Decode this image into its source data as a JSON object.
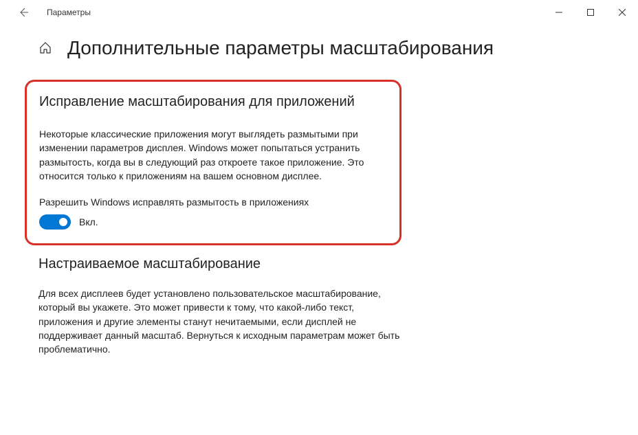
{
  "titlebar": {
    "title": "Параметры"
  },
  "page": {
    "title": "Дополнительные параметры масштабирования"
  },
  "section1": {
    "title": "Исправление масштабирования для приложений",
    "description": "Некоторые классические приложения могут выглядеть размытыми при изменении параметров дисплея. Windows может попытаться устранить размытость, когда вы в следующий раз откроете такое приложение. Это относится только к приложениям на вашем основном дисплее.",
    "toggle_label": "Разрешить Windows исправлять размытость в приложениях",
    "toggle_state": "Вкл."
  },
  "section2": {
    "title": "Настраиваемое масштабирование",
    "description": "Для всех дисплеев будет установлено пользовательское масштабирование, который вы укажете. Это может привести к тому, что какой-либо текст, приложения и другие элементы станут нечитаемыми, если дисплей не поддерживает данный масштаб. Вернуться к исходным параметрам может быть проблематично."
  }
}
